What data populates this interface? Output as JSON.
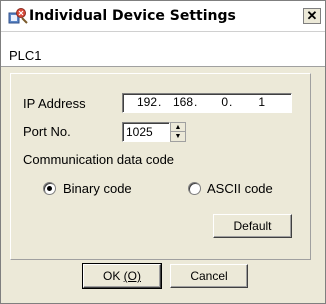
{
  "window": {
    "title": "Individual Device Settings",
    "close_glyph": "✕",
    "icon": "settings-app-icon"
  },
  "device": {
    "name": "PLC1"
  },
  "ip": {
    "label": "IP Address",
    "octets": [
      "192",
      "168",
      "0",
      "1"
    ],
    "separator": "."
  },
  "port": {
    "label": "Port No.",
    "value": "1025"
  },
  "comm": {
    "label": "Communication data code",
    "options": [
      "Binary code",
      "ASCII code"
    ],
    "selected": "Binary code"
  },
  "buttons": {
    "default": "Default",
    "ok_prefix": "OK ",
    "ok_accel": "(O)",
    "cancel": "Cancel"
  }
}
